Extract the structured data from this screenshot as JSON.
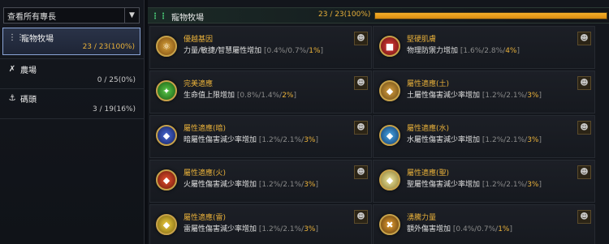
{
  "sidebar": {
    "filter_value": "查看所有專長",
    "categories": [
      {
        "label": "寵物牧場",
        "count": "23 / 23(100%)"
      },
      {
        "label": "農場",
        "count": "0 / 25(0%)"
      },
      {
        "label": "碼頭",
        "count": "3 / 19(16%)"
      }
    ]
  },
  "header": {
    "title": "寵物牧場",
    "count": "23 / 23(100%)",
    "progress": 1.0
  },
  "colors": {
    "accent": "#e8b03a",
    "active_border": "#8aa4d6",
    "header_icon": "#4cd07a"
  },
  "skills": [
    {
      "title": "優越基因",
      "desc": "力量/敏捷/智慧屬性增加",
      "v1": "[0.4%/0.7%/",
      "v2": "1%",
      "v3": "]",
      "icon": "gene-icon",
      "pet": "pet-panda-icon"
    },
    {
      "title": "堅硬肌膚",
      "desc": "物理防禦力增加",
      "v1": "[1.6%/2.8%/",
      "v2": "4%",
      "v3": "]",
      "icon": "armor-icon",
      "pet": "pet-cat-icon"
    },
    {
      "title": "完美適應",
      "desc": "生命值上限增加",
      "v1": "[0.8%/1.4%/",
      "v2": "2%",
      "v3": "]",
      "icon": "adapt-icon",
      "pet": "pet-fox-icon"
    },
    {
      "title": "屬性適應(土)",
      "desc": "土屬性傷害減少率增加",
      "v1": "[1.2%/2.1%/",
      "v2": "3%",
      "v3": "]",
      "icon": "earth-shield-icon",
      "pet": "pet-rabbit-icon"
    },
    {
      "title": "屬性適應(暗)",
      "desc": "暗屬性傷害減少率增加",
      "v1": "[1.2%/2.1%/",
      "v2": "3%",
      "v3": "]",
      "icon": "dark-shield-icon",
      "pet": "pet-donkey-icon"
    },
    {
      "title": "屬性適應(水)",
      "desc": "水屬性傷害減少率增加",
      "v1": "[1.2%/2.1%/",
      "v2": "3%",
      "v3": "]",
      "icon": "water-shield-icon",
      "pet": "pet-sprout-icon"
    },
    {
      "title": "屬性適應(火)",
      "desc": "火屬性傷害減少率增加",
      "v1": "[1.2%/2.1%/",
      "v2": "3%",
      "v3": "]",
      "icon": "fire-shield-icon",
      "pet": "pet-snowman-icon"
    },
    {
      "title": "屬性適應(聖)",
      "desc": "聖屬性傷害減少率增加",
      "v1": "[1.2%/2.1%/",
      "v2": "3%",
      "v3": "]",
      "icon": "holy-shield-icon",
      "pet": "pet-dog-icon"
    },
    {
      "title": "屬性適應(雷)",
      "desc": "雷屬性傷害減少率增加",
      "v1": "[1.2%/2.1%/",
      "v2": "3%",
      "v3": "]",
      "icon": "lightning-shield-icon",
      "pet": "pet-ghost-icon"
    },
    {
      "title": "湧騰力量",
      "desc": "額外傷害增加",
      "v1": "[0.4%/0.7%/",
      "v2": "1%",
      "v3": "]",
      "icon": "power-icon",
      "pet": "pet-warrior-icon"
    }
  ]
}
